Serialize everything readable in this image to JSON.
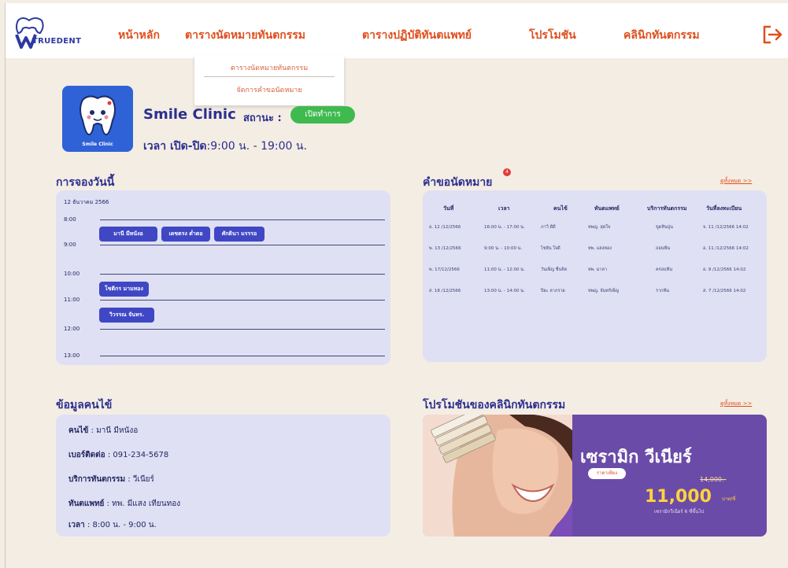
{
  "header": {
    "logo_text": "TRUEDENT",
    "nav": [
      {
        "label": "หน้าหลัก"
      },
      {
        "label": "ตารางนัดหมายทันตกรรม"
      },
      {
        "label": "ตารางปฏิบัติทันตแพทย์"
      },
      {
        "label": "โปรโมชัน"
      },
      {
        "label": "คลินิกทันตกรรม"
      }
    ]
  },
  "dropdown": {
    "items": [
      {
        "label": "ตารางนัดหมายทันตกรรม"
      },
      {
        "label": "จัดการคำขอนัดหมาย"
      }
    ]
  },
  "clinic": {
    "logo_caption": "Smile Clinic",
    "name": "Smile Clinic",
    "status_label": "สถานะ :",
    "status_value": "เปิดทำการ",
    "hours_label": "เวลา เปิด-ปิด",
    "hours_value": ":9:00 น. - 19:00 น."
  },
  "today": {
    "title": "การจองวันนี้",
    "date": "12 ธันวาคม 2566",
    "times": [
      "8:00",
      "9:00",
      "10:00",
      "11:00",
      "12:00",
      "13:00"
    ],
    "bookings": [
      {
        "label": "มานี มีหนังอ"
      },
      {
        "label": "เดชตรง ต่ำตอ"
      },
      {
        "label": "ศักดินา มรรรอ"
      },
      {
        "label": "โชติกร มามทอง"
      },
      {
        "label": "วิวรรณ จันทร."
      }
    ]
  },
  "requests": {
    "title": "คำขอนัดหมาย",
    "notif_count": "4",
    "see_all": "ดูทั้งหมด >>",
    "headers": [
      "วันที่",
      "เวลา",
      "คนไข้",
      "ทันตแพทย์",
      "บริการทันตกรรม",
      "วันที่ลงทะเบียน"
    ],
    "rows": [
      [
        "อ. 12 /12/2566",
        "16:00 น. - 17:00 น.",
        "ภาวี ดีดี",
        "ทพญ. สุดใจ",
        "ขูดหินปูน",
        "จ. 11 /12/2566 14:02"
      ],
      [
        "พ. 13 /12/2566",
        "9:00 น. - 10:00 น.",
        "ไชยัน ใจดี",
        "ทพ. แสงทอง",
        "ถอนฟัน",
        "อ. 11 /12/2566 14:02"
      ],
      [
        "พ. 17/12/2566",
        "11:00 น. - 12:00 น.",
        "วันเพ็ญ ชื่นจิต",
        "ทพ. มาลา",
        "ครอบฟัน",
        "อ. 9 /12/2566 14:02"
      ],
      [
        "ส. 18 /12/2566",
        "13:00 น. - 14:00 น.",
        "ปิยะ ลาภรวย",
        "ทพญ. จันทร์เพ็ญ",
        "รากฟัน",
        "ส. 7 /12/2566 14:02"
      ]
    ]
  },
  "patient": {
    "title": "ข้อมูลคนไข้",
    "name_label": "คนไข้",
    "name_value": " : มานี มีหนังอ",
    "phone_label": "เบอร์ติดต่อ",
    "phone_value": " : 091-234-5678",
    "service_label": "บริการทันตกรรม",
    "service_value": " : วีเนียร์",
    "dentist_label": "ทันตแพทย์",
    "dentist_value": " : ทพ. มีแสง เทียนทอง",
    "time_label": "เวลา",
    "time_value": " : 8:00 น. - 9:00 น."
  },
  "promo": {
    "title": "โปรโมชันของคลินิกทันตกรรม",
    "see_all": "ดูทั้งหมด >>",
    "headline": "เซรามิก วีเนียร์",
    "tag": "ราคาเพียง",
    "old_price": "14,000.-",
    "price": "11,000",
    "unit": "บาท/ซี่",
    "note": "เซรามิกวีเนียร์ 6 ซี่ขึ้นไป"
  }
}
